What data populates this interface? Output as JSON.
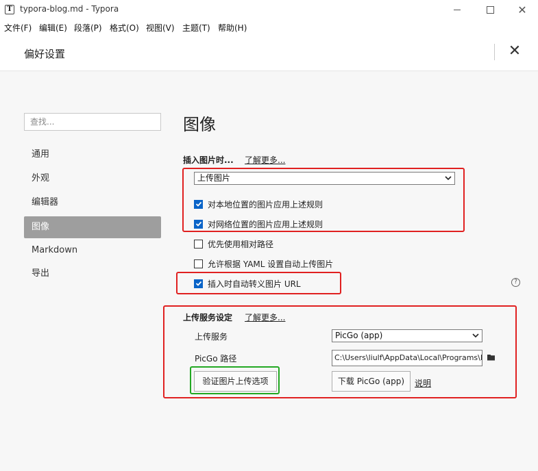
{
  "window": {
    "icon_letter": "T",
    "title": "typora-blog.md - Typora",
    "minimize_icon": "minimize-icon",
    "maximize_icon": "maximize-icon",
    "close_glyph": "✕"
  },
  "menu": [
    "文件(F)",
    "编辑(E)",
    "段落(P)",
    "格式(O)",
    "视图(V)",
    "主题(T)",
    "帮助(H)"
  ],
  "prefs": {
    "title": "偏好设置",
    "close_glyph": "✕"
  },
  "sidebar": {
    "search_placeholder": "查找...",
    "items": [
      "通用",
      "外观",
      "编辑器",
      "图像",
      "Markdown",
      "导出"
    ],
    "active_index": 3
  },
  "main": {
    "heading": "图像",
    "insert": {
      "title": "插入图片时...",
      "learn_more": "了解更多...",
      "action_selected": "上传图片",
      "options": [
        {
          "label": "对本地位置的图片应用上述规则",
          "checked": true
        },
        {
          "label": "对网络位置的图片应用上述规则",
          "checked": true
        },
        {
          "label": "优先使用相对路径",
          "checked": false
        },
        {
          "label": "允许根据 YAML 设置自动上传图片",
          "checked": false
        },
        {
          "label": "插入时自动转义图片 URL",
          "checked": true
        }
      ],
      "help_glyph": "?"
    },
    "upload": {
      "title": "上传服务设定",
      "learn_more": "了解更多...",
      "service_label": "上传服务",
      "service_selected": "PicGo (app)",
      "path_label": "PicGo 路径",
      "path_value": "C:\\Users\\liulf\\AppData\\Local\\Programs\\PicGo\\PicGo.exe",
      "validate_button": "验证图片上传选项",
      "download_button": "下载 PicGo (app)",
      "explain_link": "说明"
    }
  },
  "colors": {
    "highlight_red": "#e02020",
    "highlight_green": "#22a822",
    "checkbox_blue": "#0a64c8",
    "sidebar_active": "#9e9e9e"
  }
}
